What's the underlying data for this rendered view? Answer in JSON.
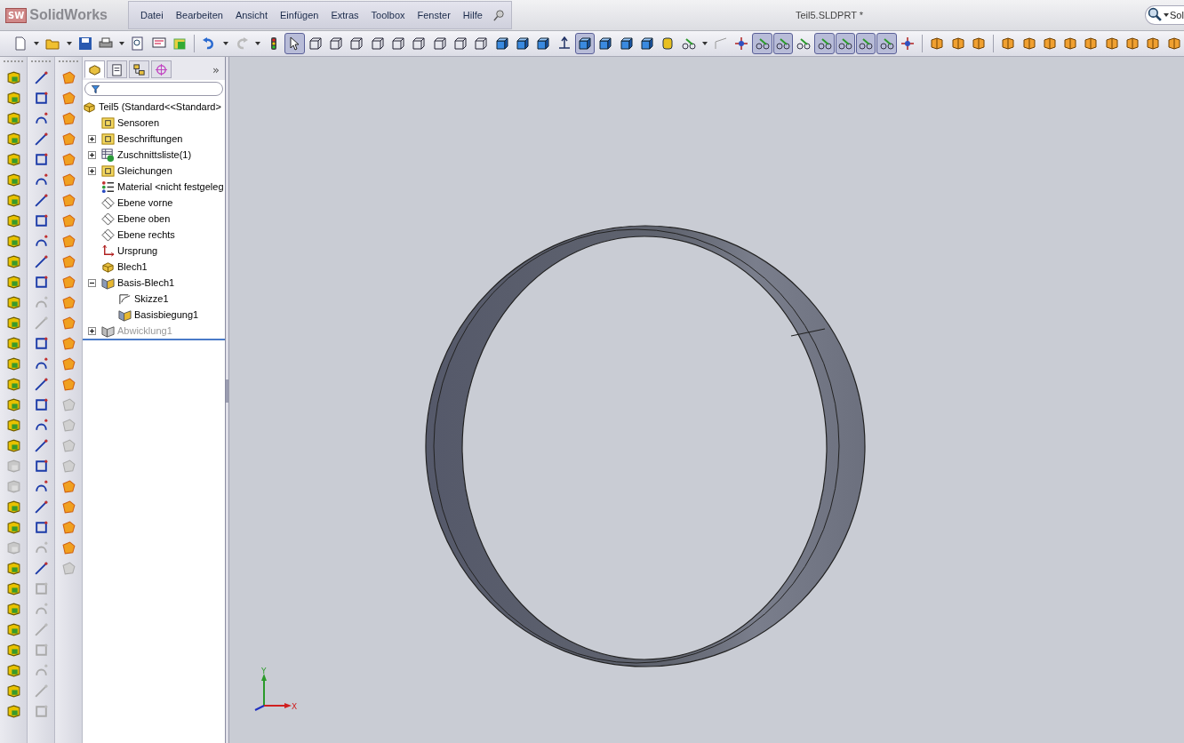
{
  "app": {
    "logo_badge": "SW",
    "logo": "SolidWorks"
  },
  "menu": [
    "Datei",
    "Bearbeiten",
    "Ansicht",
    "Einfügen",
    "Extras",
    "Toolbox",
    "Fenster",
    "Hilfe"
  ],
  "document_title": "Teil5.SLDPRT *",
  "search": {
    "placeholder": "Sol"
  },
  "toolbar": [
    {
      "kind": "doc",
      "on": false
    },
    {
      "kind": "caret"
    },
    {
      "kind": "folder",
      "on": false
    },
    {
      "kind": "caret"
    },
    {
      "kind": "save",
      "on": false
    },
    {
      "kind": "print",
      "on": false
    },
    {
      "kind": "caret"
    },
    {
      "kind": "preview",
      "on": false
    },
    {
      "kind": "form",
      "on": false
    },
    {
      "kind": "rebuild",
      "on": false
    },
    {
      "kind": "separator"
    },
    {
      "kind": "undo",
      "on": false
    },
    {
      "kind": "caret"
    },
    {
      "kind": "redo",
      "on": false
    },
    {
      "kind": "caret"
    },
    {
      "kind": "light",
      "on": false
    },
    {
      "kind": "pointer",
      "on": true
    },
    {
      "kind": "wire-cube",
      "on": false
    },
    {
      "kind": "wire-cube",
      "on": false
    },
    {
      "kind": "wire-cube",
      "on": false
    },
    {
      "kind": "wire-cube",
      "on": false
    },
    {
      "kind": "wire-cube",
      "on": false
    },
    {
      "kind": "wire-cube",
      "on": false
    },
    {
      "kind": "wire-cube",
      "on": false
    },
    {
      "kind": "wire-cube",
      "on": false
    },
    {
      "kind": "wire-cube",
      "on": false
    },
    {
      "kind": "solid-cube",
      "on": false
    },
    {
      "kind": "solid-cube",
      "on": false
    },
    {
      "kind": "solid-cube",
      "on": false
    },
    {
      "kind": "normal",
      "on": false
    },
    {
      "kind": "solid-cube",
      "on": true
    },
    {
      "kind": "solid-cube",
      "on": false
    },
    {
      "kind": "solid-cube",
      "on": false
    },
    {
      "kind": "solid-cube",
      "on": false
    },
    {
      "kind": "cylinder",
      "on": false
    },
    {
      "kind": "glasses",
      "on": false
    },
    {
      "kind": "caret"
    },
    {
      "kind": "sketch",
      "on": false
    },
    {
      "kind": "move",
      "on": false
    },
    {
      "kind": "glasses",
      "on": true
    },
    {
      "kind": "glasses",
      "on": true
    },
    {
      "kind": "glasses",
      "on": false
    },
    {
      "kind": "glasses",
      "on": true
    },
    {
      "kind": "glasses",
      "on": true
    },
    {
      "kind": "glasses",
      "on": true
    },
    {
      "kind": "glasses",
      "on": true
    },
    {
      "kind": "move",
      "on": false
    },
    {
      "kind": "separator"
    },
    {
      "kind": "tool",
      "on": false
    },
    {
      "kind": "tool",
      "on": false
    },
    {
      "kind": "tool",
      "on": false
    },
    {
      "kind": "separator"
    },
    {
      "kind": "tool",
      "on": false
    },
    {
      "kind": "tool",
      "on": false
    },
    {
      "kind": "tool",
      "on": false
    },
    {
      "kind": "tool",
      "on": false
    },
    {
      "kind": "tool",
      "on": false
    },
    {
      "kind": "tool",
      "on": false
    },
    {
      "kind": "tool",
      "on": false
    },
    {
      "kind": "tool",
      "on": false
    },
    {
      "kind": "tool",
      "on": false
    }
  ],
  "side_toolbars": [
    [
      {
        "disabled": false
      },
      {
        "disabled": false
      },
      {
        "disabled": false
      },
      {
        "disabled": false
      },
      {
        "disabled": false
      },
      {
        "disabled": false
      },
      {
        "disabled": false
      },
      {
        "disabled": false
      },
      {
        "disabled": false
      },
      {
        "disabled": false
      },
      {
        "disabled": false
      },
      {
        "disabled": false
      },
      {
        "disabled": false
      },
      {
        "disabled": false
      },
      {
        "disabled": false
      },
      {
        "disabled": false
      },
      {
        "disabled": false
      },
      {
        "disabled": false
      },
      {
        "disabled": false
      },
      {
        "disabled": true
      },
      {
        "disabled": true
      },
      {
        "disabled": false
      },
      {
        "disabled": false
      },
      {
        "disabled": true
      },
      {
        "disabled": false
      },
      {
        "disabled": false
      },
      {
        "disabled": false
      },
      {
        "disabled": false
      },
      {
        "disabled": false
      },
      {
        "disabled": false
      },
      {
        "disabled": false
      },
      {
        "disabled": false
      }
    ],
    [
      {
        "disabled": false
      },
      {
        "disabled": false
      },
      {
        "disabled": false
      },
      {
        "disabled": false
      },
      {
        "disabled": false
      },
      {
        "disabled": false
      },
      {
        "disabled": false
      },
      {
        "disabled": false
      },
      {
        "disabled": false
      },
      {
        "disabled": false
      },
      {
        "disabled": false
      },
      {
        "disabled": true
      },
      {
        "disabled": true
      },
      {
        "disabled": false
      },
      {
        "disabled": false
      },
      {
        "disabled": false
      },
      {
        "disabled": false
      },
      {
        "disabled": false
      },
      {
        "disabled": false
      },
      {
        "disabled": false
      },
      {
        "disabled": false
      },
      {
        "disabled": false
      },
      {
        "disabled": false
      },
      {
        "disabled": true
      },
      {
        "disabled": false
      },
      {
        "disabled": true
      },
      {
        "disabled": true
      },
      {
        "disabled": true
      },
      {
        "disabled": true
      },
      {
        "disabled": true
      },
      {
        "disabled": true
      },
      {
        "disabled": true
      }
    ],
    [
      {
        "disabled": false
      },
      {
        "disabled": false
      },
      {
        "disabled": false
      },
      {
        "disabled": false
      },
      {
        "disabled": false
      },
      {
        "disabled": false
      },
      {
        "disabled": false
      },
      {
        "disabled": false
      },
      {
        "disabled": false
      },
      {
        "disabled": false
      },
      {
        "disabled": false
      },
      {
        "disabled": false
      },
      {
        "disabled": false
      },
      {
        "disabled": false
      },
      {
        "disabled": false
      },
      {
        "disabled": false
      },
      {
        "disabled": true
      },
      {
        "disabled": true
      },
      {
        "disabled": true
      },
      {
        "disabled": true
      },
      {
        "disabled": false
      },
      {
        "disabled": false
      },
      {
        "disabled": false
      },
      {
        "disabled": false
      },
      {
        "disabled": true
      }
    ]
  ],
  "panel": {
    "tabs": [
      {
        "selected": true
      },
      {
        "selected": false
      },
      {
        "selected": false
      },
      {
        "selected": false
      }
    ],
    "more": "»",
    "tree": {
      "label": "Teil5  (Standard<<Standard>",
      "kind": "part",
      "disabled": false,
      "children": [
        {
          "label": "Sensoren",
          "kind": "sensor",
          "expandable": false,
          "expanded": false,
          "disabled": false
        },
        {
          "label": "Beschriftungen",
          "kind": "annotation",
          "expandable": true,
          "expanded": false,
          "disabled": false
        },
        {
          "label": "Zuschnittsliste(1)",
          "kind": "cutlist",
          "expandable": true,
          "expanded": false,
          "disabled": false
        },
        {
          "label": "Gleichungen",
          "kind": "equation",
          "expandable": true,
          "expanded": false,
          "disabled": false
        },
        {
          "label": "Material <nicht festgeleg",
          "kind": "material",
          "expandable": false,
          "expanded": false,
          "disabled": false
        },
        {
          "label": "Ebene vorne",
          "kind": "plane",
          "expandable": false,
          "expanded": false,
          "disabled": false
        },
        {
          "label": "Ebene oben",
          "kind": "plane",
          "expandable": false,
          "expanded": false,
          "disabled": false
        },
        {
          "label": "Ebene rechts",
          "kind": "plane",
          "expandable": false,
          "expanded": false,
          "disabled": false
        },
        {
          "label": "Ursprung",
          "kind": "origin",
          "expandable": false,
          "expanded": false,
          "disabled": false
        },
        {
          "label": "Blech1",
          "kind": "sheetmetal",
          "expandable": false,
          "expanded": false,
          "disabled": false
        },
        {
          "label": "Basis-Blech1",
          "kind": "feature",
          "expandable": true,
          "expanded": true,
          "disabled": false,
          "children": [
            {
              "label": "Skizze1",
              "kind": "sketch",
              "expandable": false,
              "expanded": false,
              "disabled": false
            },
            {
              "label": "Basisbiegung1",
              "kind": "bend",
              "expandable": false,
              "expanded": false,
              "disabled": false
            }
          ]
        },
        {
          "label": "Abwicklung1",
          "kind": "flat",
          "expandable": true,
          "expanded": false,
          "disabled": true
        }
      ]
    }
  },
  "viewport": {
    "triad": {
      "y": "Y",
      "x": "X"
    }
  }
}
